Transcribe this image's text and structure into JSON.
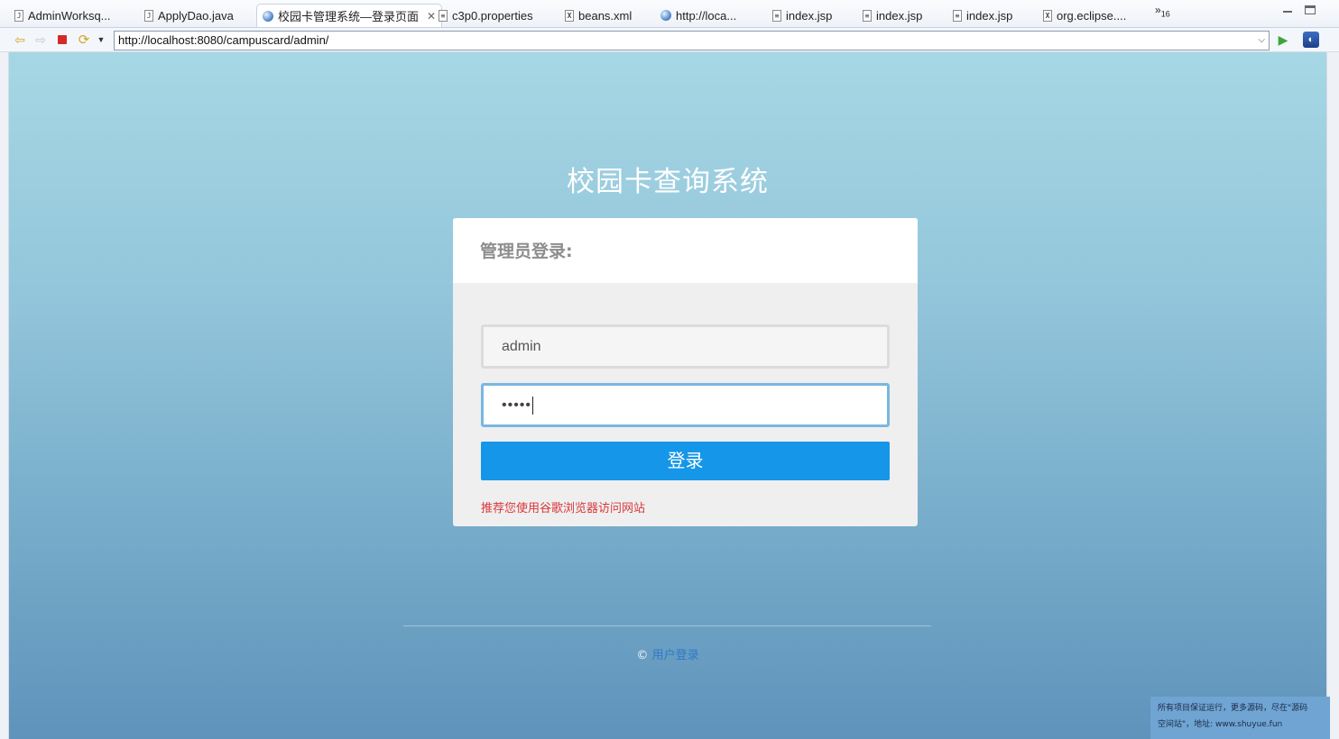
{
  "tabs": [
    {
      "label": "AdminWorksq...",
      "icon": "java-file-icon",
      "glyph": "J"
    },
    {
      "label": "ApplyDao.java",
      "icon": "java-file-icon",
      "glyph": "J"
    },
    {
      "label": "校园卡管理系统—登录页面",
      "icon": "globe-icon",
      "glyph": "",
      "active": true
    },
    {
      "label": "c3p0.properties",
      "icon": "properties-file-icon",
      "glyph": "≡"
    },
    {
      "label": "beans.xml",
      "icon": "xml-file-icon",
      "glyph": "X"
    },
    {
      "label": "http://loca...",
      "icon": "globe-icon",
      "glyph": ""
    },
    {
      "label": "index.jsp",
      "icon": "jsp-file-icon",
      "glyph": "≡"
    },
    {
      "label": "index.jsp",
      "icon": "jsp-file-icon",
      "glyph": "≡"
    },
    {
      "label": "index.jsp",
      "icon": "jsp-file-icon",
      "glyph": "≡"
    },
    {
      "label": "org.eclipse....",
      "icon": "xml-file-icon",
      "glyph": "X"
    }
  ],
  "overflow": {
    "chevron": "»",
    "count": "16"
  },
  "toolbar": {
    "url": "http://localhost:8080/campuscard/admin/"
  },
  "page": {
    "site_title": "校园卡查询系统",
    "card_heading": "管理员登录:",
    "username_value": "admin",
    "password_mask": "•••••",
    "login_label": "登录",
    "notice": "推荐您使用谷歌浏览器访问网站",
    "footer_copyright": "©",
    "footer_link": "用户登录"
  },
  "watermark": {
    "line1": "所有项目保证运行，更多源码，尽在\"源码",
    "line2": "空间站\"，地址: www.shuyue.fun"
  },
  "colors": {
    "login_button": "#1596e8",
    "notice_text": "#d9373b",
    "page_gradient_top": "#a6d7e4",
    "page_gradient_bottom": "#5f93bb"
  }
}
